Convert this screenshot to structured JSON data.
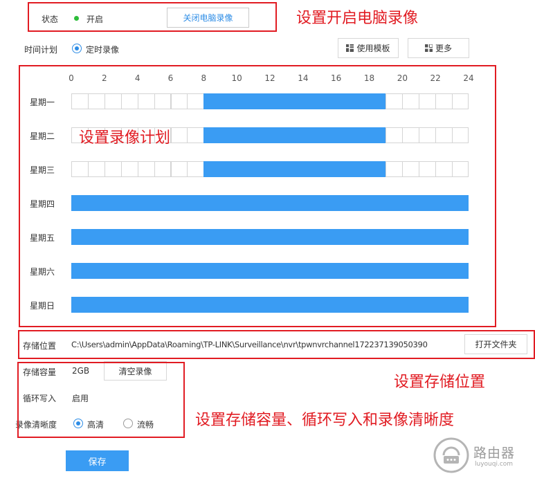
{
  "status": {
    "label": "状态",
    "value": "开启",
    "status_color": "#2dbd3a",
    "toggle_button": "关闭电脑录像"
  },
  "schedule": {
    "label": "时间计划",
    "mode": "定时录像",
    "template_button": "使用模板",
    "template_icon": "grid-icon",
    "more_button": "更多",
    "more_icon": "squares-icon",
    "hours": [
      "0",
      "2",
      "4",
      "6",
      "8",
      "10",
      "12",
      "14",
      "16",
      "18",
      "20",
      "22",
      "24"
    ],
    "days": [
      {
        "name": "星期一",
        "recorded_hours": [
          8,
          19
        ]
      },
      {
        "name": "星期二",
        "recorded_hours": [
          8,
          19
        ]
      },
      {
        "name": "星期三",
        "recorded_hours": [
          8,
          19
        ]
      },
      {
        "name": "星期四",
        "recorded_hours": [
          0,
          24
        ]
      },
      {
        "name": "星期五",
        "recorded_hours": [
          0,
          24
        ]
      },
      {
        "name": "星期六",
        "recorded_hours": [
          0,
          24
        ]
      },
      {
        "name": "星期日",
        "recorded_hours": [
          0,
          24
        ]
      }
    ],
    "slot_color": "#3a9cf3"
  },
  "storage": {
    "location_label": "存储位置",
    "location_path": "C:\\Users\\admin\\AppData\\Roaming\\TP-LINK\\Surveillance\\nvr\\tpwnvrchannel172237139050390",
    "open_folder_button": "打开文件夹",
    "capacity_label": "存储容量",
    "capacity_value": "2GB",
    "clear_button": "清空录像",
    "loop_label": "循环写入",
    "loop_value": "启用",
    "quality_label": "录像清晰度",
    "quality_options": [
      "高清",
      "流畅"
    ],
    "quality_selected": "高清"
  },
  "save_button": "保存",
  "annotations": {
    "enable_recording": "设置开启电脑录像",
    "schedule_plan": "设置录像计划",
    "storage_location": "设置存储位置",
    "storage_settings": "设置存储容量、循环写入和录像清晰度",
    "color": "#e11b22"
  },
  "watermark": {
    "main": "路由器",
    "sub": "luyouqi.com"
  }
}
